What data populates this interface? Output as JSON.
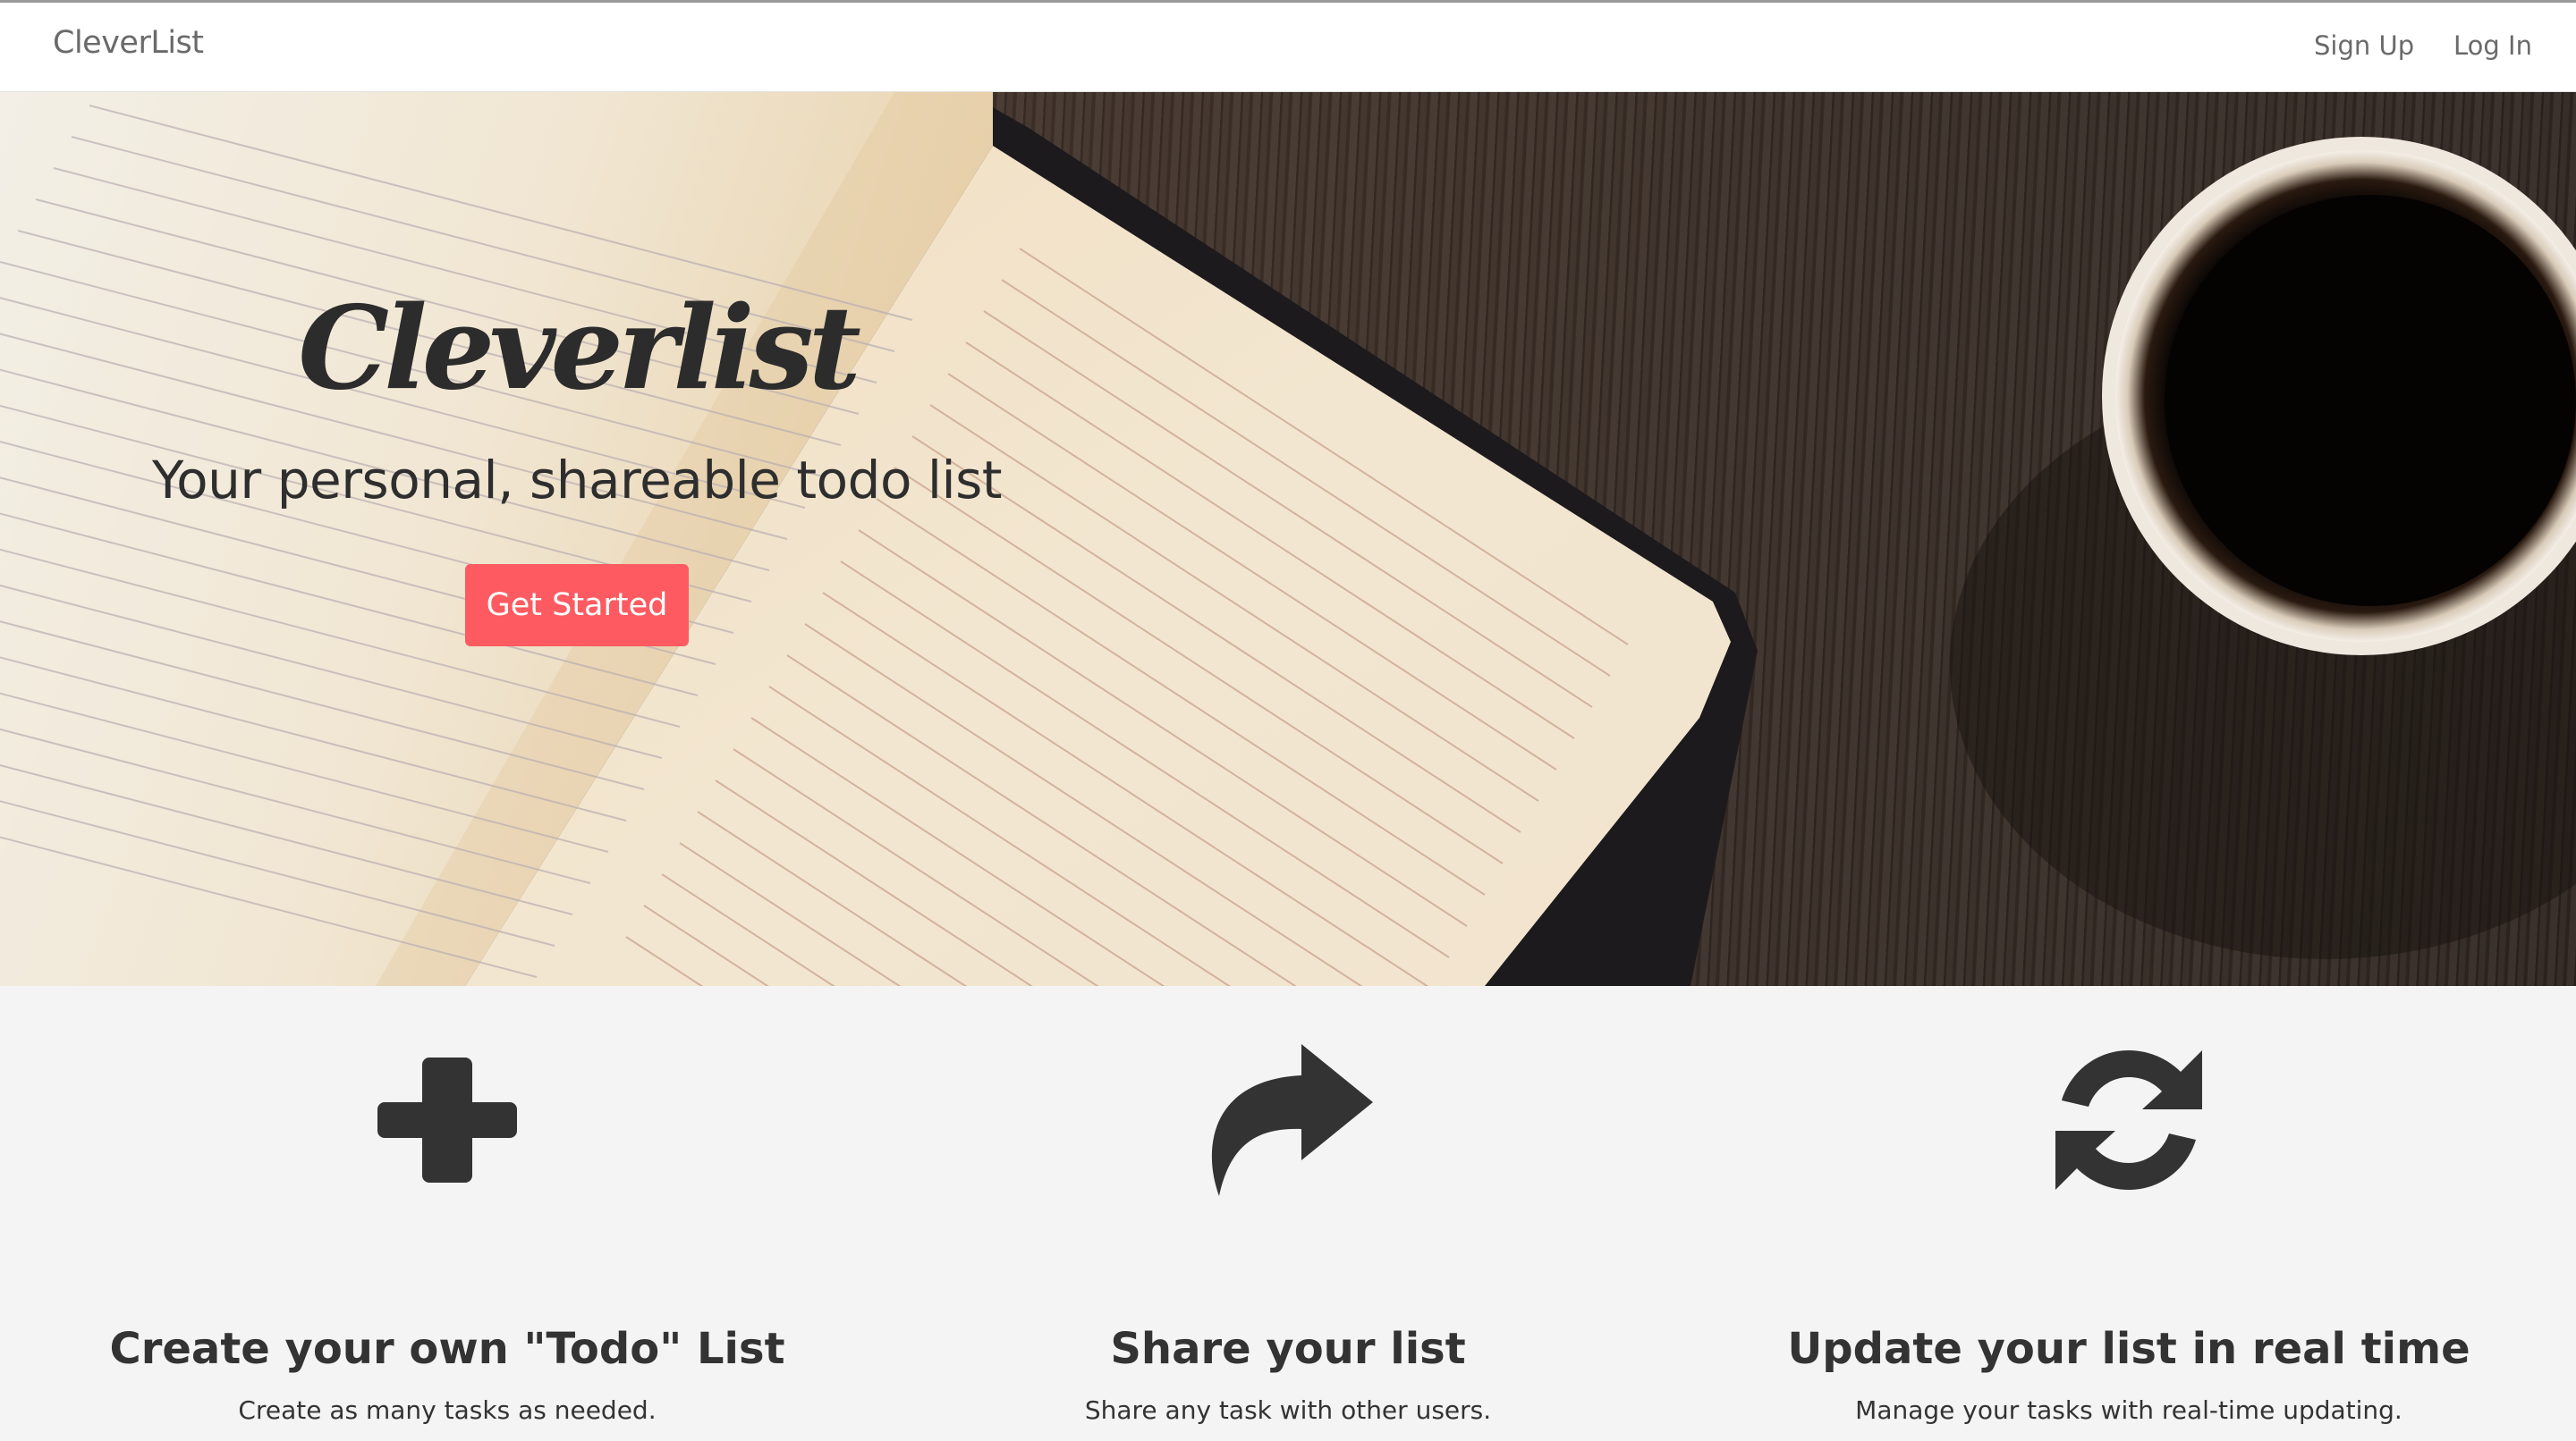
{
  "navbar": {
    "brand": "CleverList",
    "signup_label": "Sign Up",
    "login_label": "Log In"
  },
  "hero": {
    "title": "Cleverlist",
    "subtitle": "Your personal, shareable todo list",
    "cta_label": "Get Started",
    "cta_color": "#fd5b61"
  },
  "features": [
    {
      "icon": "plus-icon",
      "title": "Create your own \"Todo\" List",
      "description": "Create as many tasks as needed."
    },
    {
      "icon": "share-icon",
      "title": "Share your list",
      "description": "Share any task with other users."
    },
    {
      "icon": "sync-icon",
      "title": "Update your list in real time",
      "description": "Manage your tasks with real-time updating."
    }
  ],
  "colors": {
    "navbar_bg": "#ffffff",
    "features_bg": "#f4f4f4",
    "text": "#333333"
  }
}
